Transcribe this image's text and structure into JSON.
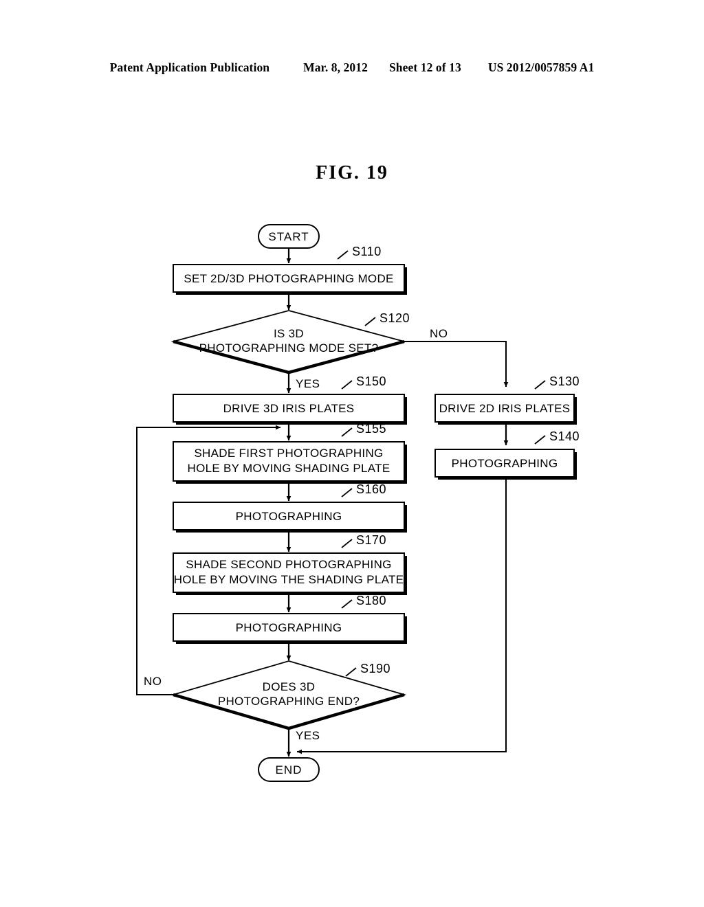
{
  "header": {
    "publication": "Patent Application Publication",
    "date": "Mar. 8, 2012",
    "sheet": "Sheet 12 of 13",
    "patent_number": "US 2012/0057859 A1"
  },
  "figure": {
    "title": "FIG.  19"
  },
  "flowchart": {
    "start_label": "START",
    "end_label": "END",
    "nodes": [
      {
        "id": "S110",
        "step": "S110",
        "text_line1": "SET 2D/3D PHOTOGRAPHING MODE",
        "text_line2": "",
        "shape": "process"
      },
      {
        "id": "S120",
        "step": "S120",
        "text_line1": "IS 3D",
        "text_line2": "PHOTOGRAPHING MODE SET?",
        "shape": "decision"
      },
      {
        "id": "S130",
        "step": "S130",
        "text_line1": "DRIVE 2D IRIS PLATES",
        "text_line2": "",
        "shape": "process"
      },
      {
        "id": "S140",
        "step": "S140",
        "text_line1": "PHOTOGRAPHING",
        "text_line2": "",
        "shape": "process"
      },
      {
        "id": "S150",
        "step": "S150",
        "text_line1": "DRIVE 3D IRIS PLATES",
        "text_line2": "",
        "shape": "process"
      },
      {
        "id": "S155",
        "step": "S155",
        "text_line1": "SHADE FIRST PHOTOGRAPHING",
        "text_line2": "HOLE BY MOVING SHADING PLATE",
        "shape": "process"
      },
      {
        "id": "S160",
        "step": "S160",
        "text_line1": "PHOTOGRAPHING",
        "text_line2": "",
        "shape": "process"
      },
      {
        "id": "S170",
        "step": "S170",
        "text_line1": "SHADE SECOND PHOTOGRAPHING",
        "text_line2": "HOLE BY MOVING THE SHADING PLATE",
        "shape": "process"
      },
      {
        "id": "S180",
        "step": "S180",
        "text_line1": "PHOTOGRAPHING",
        "text_line2": "",
        "shape": "process"
      },
      {
        "id": "S190",
        "step": "S190",
        "text_line1": "DOES 3D",
        "text_line2": "PHOTOGRAPHING END?",
        "shape": "decision"
      }
    ],
    "branch_labels": {
      "s120_no": "NO",
      "s120_yes": "YES",
      "s190_no": "NO",
      "s190_yes": "YES"
    }
  }
}
